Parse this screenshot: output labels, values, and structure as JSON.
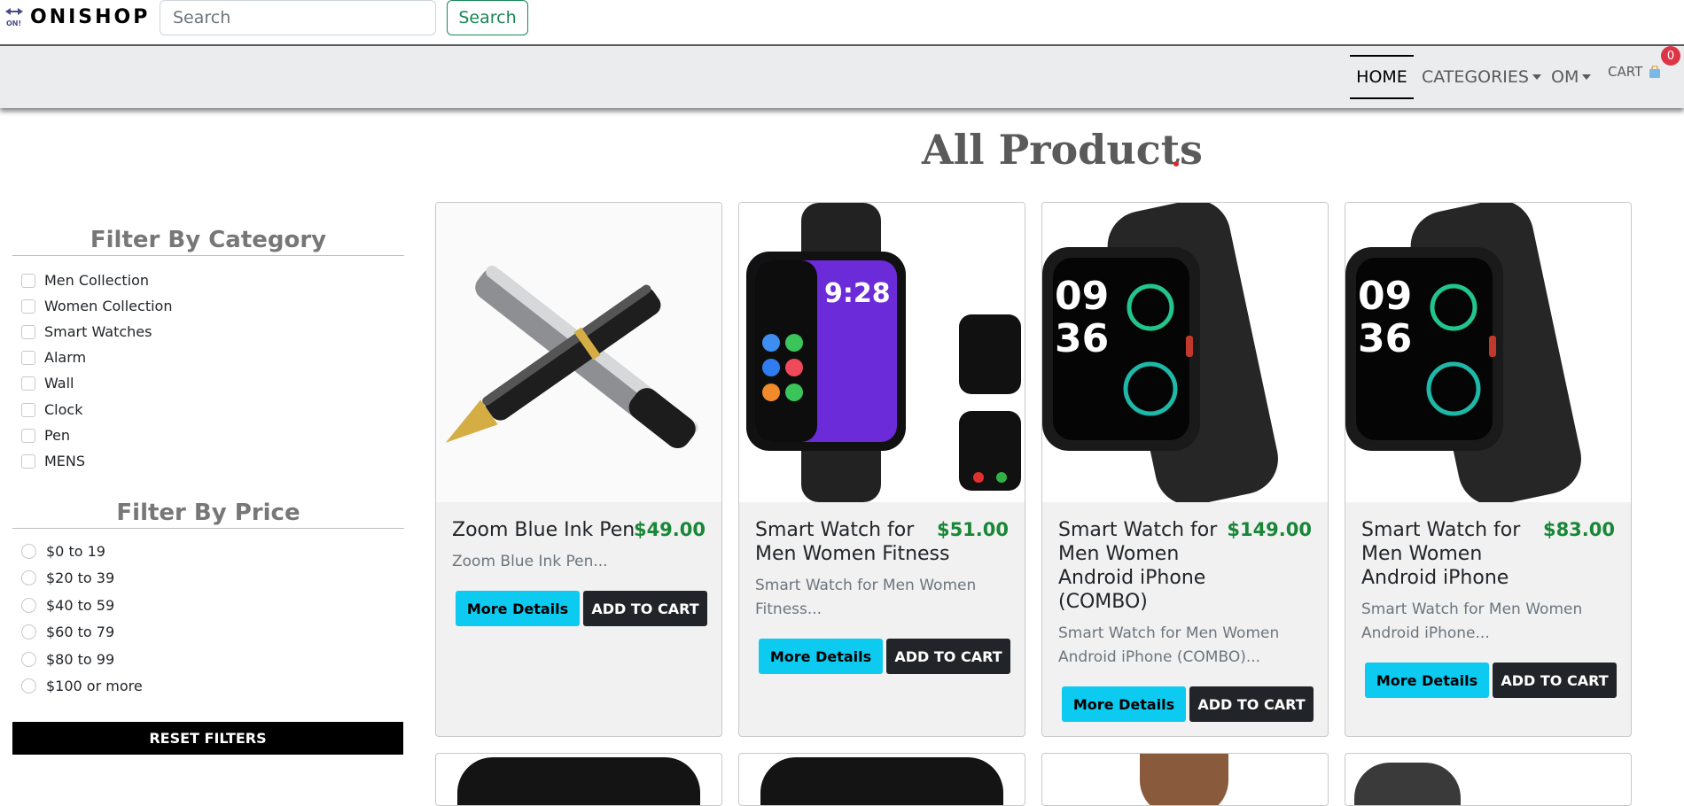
{
  "header": {
    "brand_name": "ONISHOP",
    "logo_text": "ON!",
    "search_placeholder": "Search",
    "search_button": "Search"
  },
  "nav": {
    "home": "HOME",
    "categories": "CATEGORIES",
    "user": "OM",
    "cart": "CART",
    "cart_count": "0"
  },
  "main": {
    "title": "All Products"
  },
  "filters": {
    "category_heading": "Filter By Category",
    "categories": [
      "Men Collection",
      "Women Collection",
      "Smart Watches",
      "Alarm",
      "Wall",
      "Clock",
      "Pen",
      "MENS"
    ],
    "price_heading": "Filter By Price",
    "prices": [
      "$0 to 19",
      "$20 to 39",
      "$40 to 59",
      "$60 to 79",
      "$80 to 99",
      "$100 or more"
    ],
    "reset_button": "RESET FILTERS"
  },
  "products": [
    {
      "name_lines": [
        "Zoom Blue Ink Pen"
      ],
      "price": "$49.00",
      "desc_lines": [
        "Zoom Blue Ink Pen..."
      ],
      "image": "pen-image"
    },
    {
      "name_lines": [
        "Smart Watch for",
        "Men Women Fitness"
      ],
      "price": "$51.00",
      "desc_lines": [
        "Smart Watch for Men Women",
        "Fitness..."
      ],
      "image": "watch-image"
    },
    {
      "name_lines": [
        "Smart Watch for",
        "Men Women",
        "Android iPhone",
        "(COMBO)"
      ],
      "price": "$149.00",
      "desc_lines": [
        "Smart Watch for Men Women",
        "Android iPhone (COMBO)..."
      ],
      "image": "watch-image"
    },
    {
      "name_lines": [
        "Smart Watch for",
        "Men Women",
        "Android iPhone"
      ],
      "price": "$83.00",
      "desc_lines": [
        "Smart Watch for Men Women",
        "Android iPhone..."
      ],
      "image": "watch-image"
    }
  ],
  "product_buttons": {
    "more_details": "More Details",
    "add_to_cart": "ADD TO CART"
  },
  "colors": {
    "price": "#198737",
    "more_details_bg": "#0dcaf0",
    "add_to_cart_bg": "#212529",
    "search_button": "#198754",
    "cart_badge": "#dc3545"
  }
}
